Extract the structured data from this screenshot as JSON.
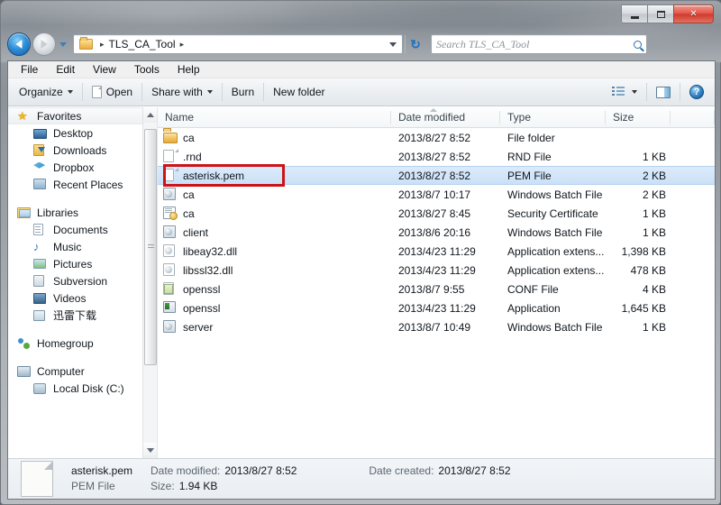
{
  "window": {
    "caption_buttons": [
      {
        "name": "minimize",
        "glyph": "minimize-icon"
      },
      {
        "name": "maximize",
        "glyph": "maximize-icon"
      },
      {
        "name": "close",
        "glyph": "×"
      }
    ]
  },
  "navigation": {
    "back_title": "Back",
    "forward_title": "Forward",
    "recent_caret": "▾",
    "refresh_glyph": "↻"
  },
  "address": {
    "separator": "▸",
    "path_segment": "TLS_CA_Tool",
    "folder_icon": "folder-icon",
    "dropdown_icon": "chevron-down-icon"
  },
  "search": {
    "placeholder": "Search TLS_CA_Tool",
    "value": "",
    "icon": "search-icon"
  },
  "menu": {
    "items": [
      "File",
      "Edit",
      "View",
      "Tools",
      "Help"
    ]
  },
  "toolbar": {
    "organize": "Organize",
    "open": "Open",
    "share_with": "Share with",
    "burn": "Burn",
    "new_folder": "New folder",
    "views_icon": "views-list-icon",
    "preview_pane_icon": "preview-pane-icon",
    "help_icon": "help-icon",
    "help_glyph": "?"
  },
  "navpane": {
    "groups": [
      {
        "header": {
          "label": "Favorites",
          "icon": "star-icon",
          "selected": true
        },
        "items": [
          {
            "label": "Desktop",
            "icon": "desktop-icon"
          },
          {
            "label": "Downloads",
            "icon": "downloads-icon"
          },
          {
            "label": "Dropbox",
            "icon": "dropbox-icon"
          },
          {
            "label": "Recent Places",
            "icon": "recent-places-icon"
          }
        ]
      },
      {
        "header": {
          "label": "Libraries",
          "icon": "libraries-icon",
          "selected": false
        },
        "items": [
          {
            "label": "Documents",
            "icon": "documents-icon"
          },
          {
            "label": "Music",
            "icon": "music-icon"
          },
          {
            "label": "Pictures",
            "icon": "pictures-icon"
          },
          {
            "label": "Subversion",
            "icon": "subversion-icon"
          },
          {
            "label": "Videos",
            "icon": "videos-icon"
          },
          {
            "label": "迅雷下载",
            "icon": "xunlei-download-icon"
          }
        ]
      },
      {
        "header": {
          "label": "Homegroup",
          "icon": "homegroup-icon",
          "selected": false
        },
        "items": []
      },
      {
        "header": {
          "label": "Computer",
          "icon": "computer-icon",
          "selected": false
        },
        "items": [
          {
            "label": "Local Disk (C:)",
            "icon": "disk-icon"
          }
        ]
      }
    ]
  },
  "filelist": {
    "columns": [
      {
        "label": "Name",
        "key": "name"
      },
      {
        "label": "Date modified",
        "key": "date"
      },
      {
        "label": "Type",
        "key": "type"
      },
      {
        "label": "Size",
        "key": "size"
      }
    ],
    "sort_column": "Name",
    "sort_direction": "ascending",
    "rows": [
      {
        "name": "ca",
        "date": "2013/8/27 8:52",
        "type": "File folder",
        "size": "",
        "icon": "folder-icon",
        "selected": false
      },
      {
        "name": ".rnd",
        "date": "2013/8/27 8:52",
        "type": "RND File",
        "size": "1 KB",
        "icon": "blank-file-icon",
        "selected": false
      },
      {
        "name": "asterisk.pem",
        "date": "2013/8/27 8:52",
        "type": "PEM File",
        "size": "2 KB",
        "icon": "blank-file-icon",
        "selected": true
      },
      {
        "name": "ca",
        "date": "2013/8/7 10:17",
        "type": "Windows Batch File",
        "size": "2 KB",
        "icon": "batch-file-icon",
        "selected": false
      },
      {
        "name": "ca",
        "date": "2013/8/27 8:45",
        "type": "Security Certificate",
        "size": "1 KB",
        "icon": "certificate-icon",
        "selected": false
      },
      {
        "name": "client",
        "date": "2013/8/6 20:16",
        "type": "Windows Batch File",
        "size": "1 KB",
        "icon": "batch-file-icon",
        "selected": false
      },
      {
        "name": "libeay32.dll",
        "date": "2013/4/23 11:29",
        "type": "Application extens...",
        "size": "1,398 KB",
        "icon": "dll-icon",
        "selected": false
      },
      {
        "name": "libssl32.dll",
        "date": "2013/4/23 11:29",
        "type": "Application extens...",
        "size": "478 KB",
        "icon": "dll-icon",
        "selected": false
      },
      {
        "name": "openssl",
        "date": "2013/8/7 9:55",
        "type": "CONF File",
        "size": "4 KB",
        "icon": "conf-file-icon",
        "selected": false
      },
      {
        "name": "openssl",
        "date": "2013/4/23 11:29",
        "type": "Application",
        "size": "1,645 KB",
        "icon": "application-icon",
        "selected": false
      },
      {
        "name": "server",
        "date": "2013/8/7 10:49",
        "type": "Windows Batch File",
        "size": "1 KB",
        "icon": "batch-file-icon",
        "selected": false
      }
    ],
    "annotation": {
      "target": "asterisk.pem",
      "color": "#cc1418"
    }
  },
  "statusbar": {
    "file_name": "asterisk.pem",
    "file_type": "PEM File",
    "date_modified_label": "Date modified:",
    "date_modified_value": "2013/8/27 8:52",
    "date_created_label": "Date created:",
    "date_created_value": "2013/8/27 8:52",
    "size_label": "Size:",
    "size_value": "1.94 KB",
    "icon": "pem-file-icon"
  }
}
